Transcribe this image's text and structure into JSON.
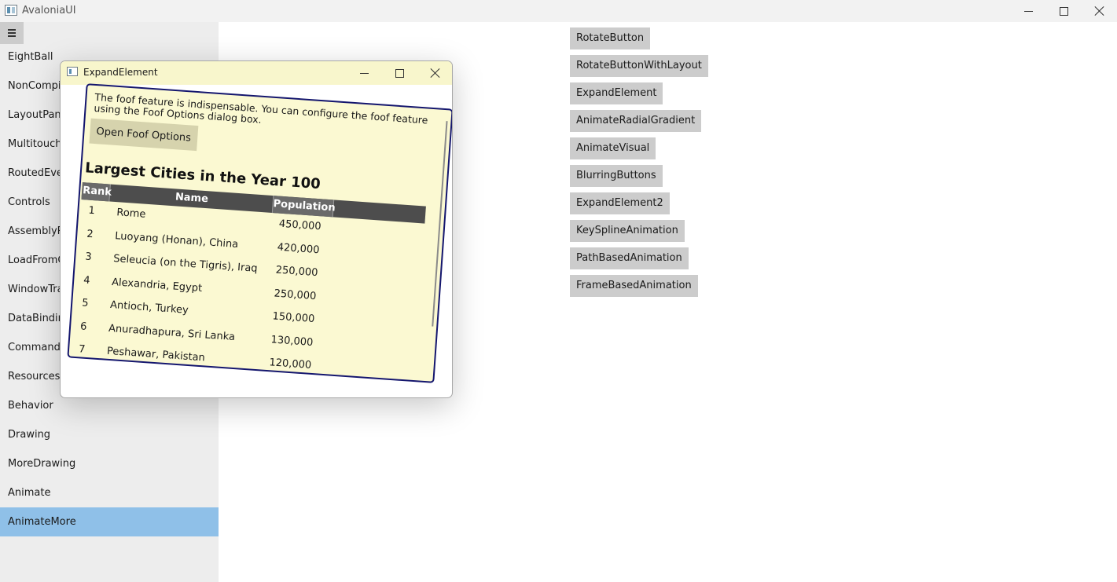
{
  "app": {
    "title": "AvaloniaUI"
  },
  "sidebar": {
    "items": [
      {
        "label": "EightBall"
      },
      {
        "label": "NonCompi"
      },
      {
        "label": "LayoutPan"
      },
      {
        "label": "Multitouch"
      },
      {
        "label": "RoutedEve"
      },
      {
        "label": "Controls"
      },
      {
        "label": "AssemblyR"
      },
      {
        "label": "LoadFromC"
      },
      {
        "label": "WindowTra"
      },
      {
        "label": "DataBindin"
      },
      {
        "label": "Commands"
      },
      {
        "label": "Resources"
      },
      {
        "label": "Behavior"
      },
      {
        "label": "Drawing"
      },
      {
        "label": "MoreDrawing"
      },
      {
        "label": "Animate"
      },
      {
        "label": "AnimateMore",
        "selected": true
      }
    ]
  },
  "buttons": [
    {
      "label": "RotateButton"
    },
    {
      "label": "RotateButtonWithLayout"
    },
    {
      "label": "ExpandElement"
    },
    {
      "label": "AnimateRadialGradient"
    },
    {
      "label": "AnimateVisual"
    },
    {
      "label": "BlurringButtons"
    },
    {
      "label": "ExpandElement2"
    },
    {
      "label": "KeySplineAnimation"
    },
    {
      "label": "PathBasedAnimation"
    },
    {
      "label": "FrameBasedAnimation"
    }
  ],
  "popup": {
    "title": "ExpandElement",
    "description": "The foof feature is indispensable. You can configure the foof feature using the Foof Options dialog box.",
    "button_label": "Open Foof Options",
    "table_title": "Largest Cities in the Year 100",
    "columns": {
      "rank": "Rank",
      "name": "Name",
      "population": "Population"
    },
    "rows": [
      {
        "rank": "1",
        "name": "Rome",
        "population": "450,000"
      },
      {
        "rank": "2",
        "name": "Luoyang (Honan), China",
        "population": "420,000"
      },
      {
        "rank": "3",
        "name": "Seleucia (on the Tigris), Iraq",
        "population": "250,000"
      },
      {
        "rank": "4",
        "name": "Alexandria, Egypt",
        "population": "250,000"
      },
      {
        "rank": "5",
        "name": "Antioch, Turkey",
        "population": "150,000"
      },
      {
        "rank": "6",
        "name": "Anuradhapura, Sri Lanka",
        "population": "130,000"
      },
      {
        "rank": "7",
        "name": "Peshawar, Pakistan",
        "population": "120,000"
      }
    ]
  },
  "colors": {
    "selected_item": "#8fc0e8",
    "popup_background": "#fbf9d2",
    "card_border": "#14166e",
    "table_header": "#4d4d4d"
  },
  "icons": {
    "app": "app-window-icon",
    "minimize": "minimize-icon",
    "maximize": "maximize-icon",
    "close": "close-icon",
    "menu": "hamburger-menu-icon"
  }
}
